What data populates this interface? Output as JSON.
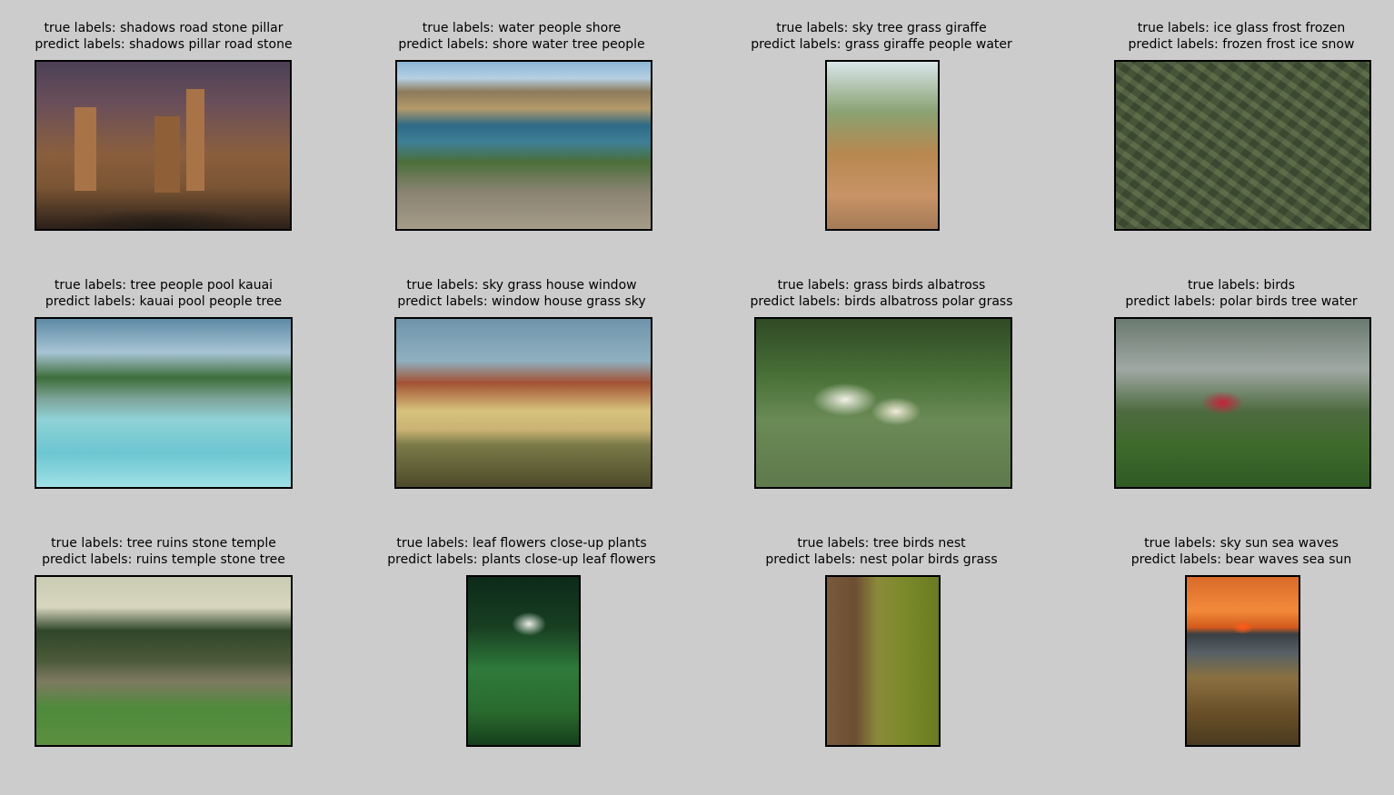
{
  "grid": [
    {
      "true_labels": "true labels: shadows road stone pillar",
      "predict_labels": "predict labels: shadows pillar road stone",
      "image_icon": "ruins-photo-icon"
    },
    {
      "true_labels": "true labels: water people shore",
      "predict_labels": "predict labels: shore water tree people",
      "image_icon": "shore-photo-icon"
    },
    {
      "true_labels": "true labels: sky tree grass giraffe",
      "predict_labels": "predict labels: grass giraffe people water",
      "image_icon": "giraffe-photo-icon"
    },
    {
      "true_labels": "true labels: ice glass frost frozen",
      "predict_labels": "predict labels: frozen frost ice snow",
      "image_icon": "ice-photo-icon"
    },
    {
      "true_labels": "true labels: tree people pool kauai",
      "predict_labels": "predict labels: kauai pool people tree",
      "image_icon": "pool-photo-icon"
    },
    {
      "true_labels": "true labels: sky grass house window",
      "predict_labels": "predict labels: window house grass sky",
      "image_icon": "house-photo-icon"
    },
    {
      "true_labels": "true labels: grass birds albatross",
      "predict_labels": "predict labels: birds albatross polar grass",
      "image_icon": "albatross-photo-icon"
    },
    {
      "true_labels": "true labels: birds",
      "predict_labels": "predict labels: polar birds tree water",
      "image_icon": "frigatebird-photo-icon"
    },
    {
      "true_labels": "true labels: tree ruins stone temple",
      "predict_labels": "predict labels: ruins temple stone tree",
      "image_icon": "temple-photo-icon"
    },
    {
      "true_labels": "true labels: leaf flowers close-up plants",
      "predict_labels": "predict labels: plants close-up leaf flowers",
      "image_icon": "flowers-photo-icon"
    },
    {
      "true_labels": "true labels: tree birds nest",
      "predict_labels": "predict labels: nest polar birds grass",
      "image_icon": "woodpecker-photo-icon"
    },
    {
      "true_labels": "true labels: sky sun sea waves",
      "predict_labels": "predict labels: bear waves sea sun",
      "image_icon": "sunset-photo-icon"
    }
  ],
  "colors": {
    "background": "#cccccc",
    "border": "#000000"
  }
}
